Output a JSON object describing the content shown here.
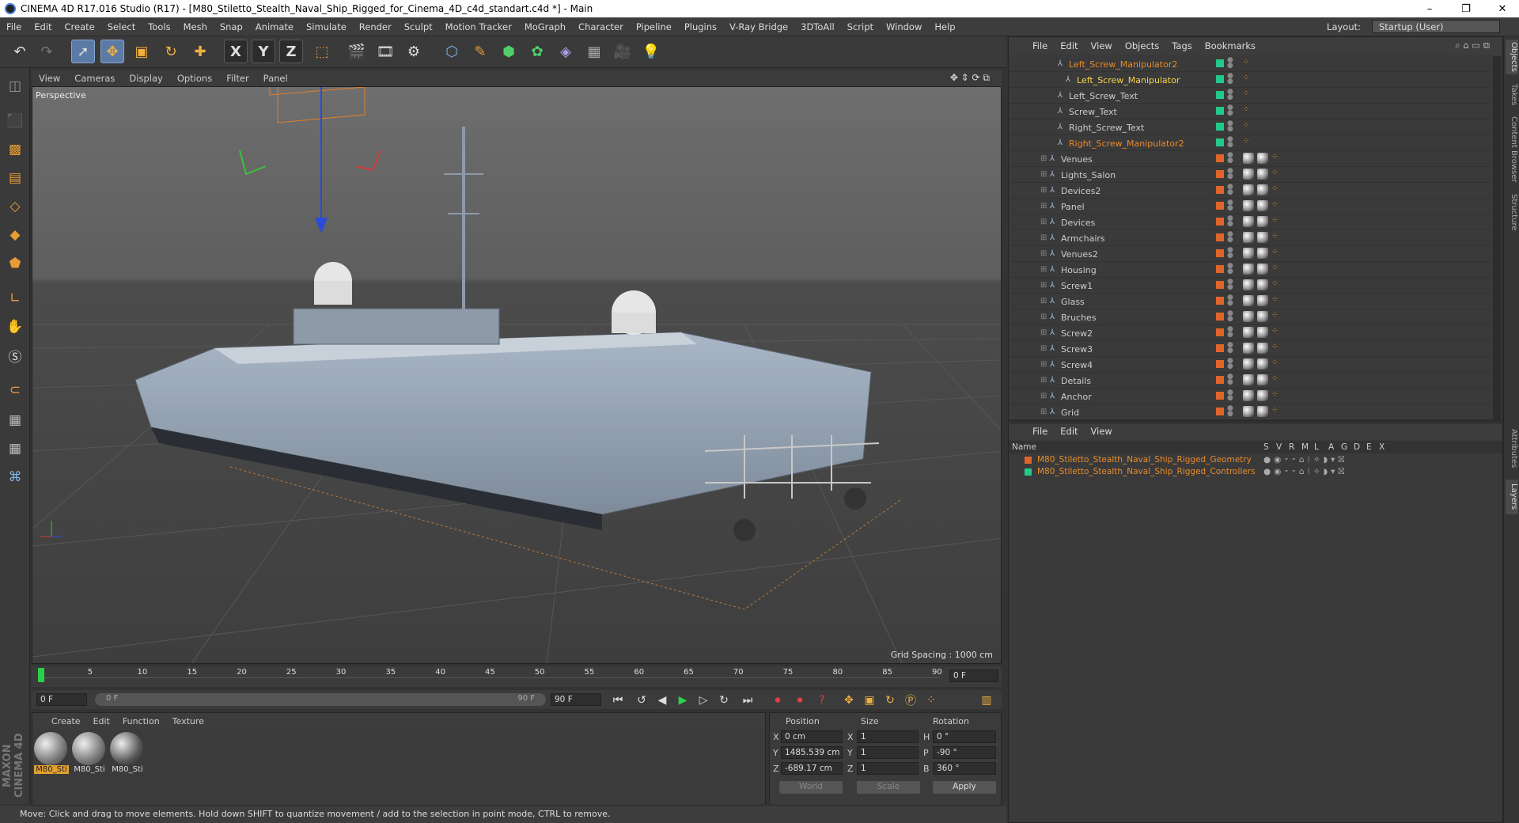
{
  "window": {
    "title": "CINEMA 4D R17.016 Studio (R17) - [M80_Stiletto_Stealth_Naval_Ship_Rigged_for_Cinema_4D_c4d_standart.c4d *] - Main",
    "minimize": "–",
    "restore": "❐",
    "close": "✕"
  },
  "menu": [
    "File",
    "Edit",
    "Create",
    "Select",
    "Tools",
    "Mesh",
    "Snap",
    "Animate",
    "Simulate",
    "Render",
    "Sculpt",
    "Motion Tracker",
    "MoGraph",
    "Character",
    "Pipeline",
    "Plugins",
    "V-Ray Bridge",
    "3DToAll",
    "Script",
    "Window",
    "Help"
  ],
  "layout": {
    "label": "Layout:",
    "value": "Startup (User)"
  },
  "toolbar": {
    "x_label": "X",
    "y_label": "Y",
    "z_label": "Z"
  },
  "viewport": {
    "menu": [
      "View",
      "Cameras",
      "Display",
      "Options",
      "Filter",
      "Panel"
    ],
    "label": "Perspective",
    "grid_spacing": "Grid Spacing : 1000 cm"
  },
  "timeline": {
    "ticks": [
      "0",
      "5",
      "10",
      "15",
      "20",
      "25",
      "30",
      "35",
      "40",
      "45",
      "50",
      "55",
      "60",
      "65",
      "70",
      "75",
      "80",
      "85",
      "90"
    ],
    "current_frame": "0 F",
    "start_field": "0 F",
    "range_start": "0 F",
    "range_end": "90 F",
    "end_field": "90 F"
  },
  "materials": {
    "menu": [
      "Create",
      "Edit",
      "Function",
      "Texture"
    ],
    "items": [
      "M80_Sti",
      "M80_Sti",
      "M80_Sti"
    ]
  },
  "coords": {
    "headers": {
      "position": "Position",
      "size": "Size",
      "rotation": "Rotation"
    },
    "rows": [
      {
        "axis": "X",
        "pos": "0 cm",
        "size_axis": "X",
        "size": "1",
        "rot_axis": "H",
        "rot": "0 °"
      },
      {
        "axis": "Y",
        "pos": "1485.539 cm",
        "size_axis": "Y",
        "size": "1",
        "rot_axis": "P",
        "rot": "-90 °"
      },
      {
        "axis": "Z",
        "pos": "-689.17 cm",
        "size_axis": "Z",
        "size": "1",
        "rot_axis": "B",
        "rot": "360 °"
      }
    ],
    "world": "World",
    "scale": "Scale",
    "apply": "Apply"
  },
  "status": "Move: Click and drag to move elements. Hold down SHIFT to quantize movement / add to the selection in point mode, CTRL to remove.",
  "brand": "MAXON CINEMA 4D",
  "objects": {
    "menu": [
      "File",
      "Edit",
      "View",
      "Objects",
      "Tags",
      "Bookmarks"
    ],
    "rows": [
      {
        "name": "Left_Screw_Manipulator2",
        "style": "hl",
        "indent": 1,
        "swatch": "#22c98a"
      },
      {
        "name": "Left_Screw_Manipulator",
        "style": "act",
        "indent": 2,
        "swatch": "#22c98a"
      },
      {
        "name": "Left_Screw_Text",
        "style": "",
        "indent": 1,
        "swatch": "#22c98a"
      },
      {
        "name": "Screw_Text",
        "style": "",
        "indent": 1,
        "swatch": "#22c98a"
      },
      {
        "name": "Right_Screw_Text",
        "style": "",
        "indent": 1,
        "swatch": "#22c98a"
      },
      {
        "name": "Right_Screw_Manipulator2",
        "style": "hl",
        "indent": 1,
        "swatch": "#22c98a"
      },
      {
        "name": "Venues",
        "style": "",
        "indent": 0,
        "swatch": "#e0652a"
      },
      {
        "name": "Lights_Salon",
        "style": "",
        "indent": 0,
        "swatch": "#e0652a"
      },
      {
        "name": "Devices2",
        "style": "",
        "indent": 0,
        "swatch": "#e0652a"
      },
      {
        "name": "Panel",
        "style": "",
        "indent": 0,
        "swatch": "#e0652a"
      },
      {
        "name": "Devices",
        "style": "",
        "indent": 0,
        "swatch": "#e0652a"
      },
      {
        "name": "Armchairs",
        "style": "",
        "indent": 0,
        "swatch": "#e0652a"
      },
      {
        "name": "Venues2",
        "style": "",
        "indent": 0,
        "swatch": "#e0652a"
      },
      {
        "name": "Housing",
        "style": "",
        "indent": 0,
        "swatch": "#e0652a"
      },
      {
        "name": "Screw1",
        "style": "",
        "indent": 0,
        "swatch": "#e0652a"
      },
      {
        "name": "Glass",
        "style": "",
        "indent": 0,
        "swatch": "#e0652a"
      },
      {
        "name": "Bruches",
        "style": "",
        "indent": 0,
        "swatch": "#e0652a"
      },
      {
        "name": "Screw2",
        "style": "",
        "indent": 0,
        "swatch": "#e0652a"
      },
      {
        "name": "Screw3",
        "style": "",
        "indent": 0,
        "swatch": "#e0652a"
      },
      {
        "name": "Screw4",
        "style": "",
        "indent": 0,
        "swatch": "#e0652a"
      },
      {
        "name": "Details",
        "style": "",
        "indent": 0,
        "swatch": "#e0652a"
      },
      {
        "name": "Anchor",
        "style": "",
        "indent": 0,
        "swatch": "#e0652a"
      },
      {
        "name": "Grid",
        "style": "",
        "indent": 0,
        "swatch": "#e0652a"
      }
    ]
  },
  "layers": {
    "menu": [
      "File",
      "Edit",
      "View"
    ],
    "headers": [
      "Name",
      "S",
      "V",
      "R",
      "M",
      "L",
      "A",
      "G",
      "D",
      "E",
      "X"
    ],
    "rows": [
      {
        "name": "M80_Stiletto_Stealth_Naval_Ship_Rigged_Geometry",
        "swatch": "#e0652a"
      },
      {
        "name": "M80_Stiletto_Stealth_Naval_Ship_Rigged_Controllers",
        "swatch": "#22c98a"
      }
    ]
  },
  "side_tabs": [
    "Objects",
    "Takes",
    "Content Browser",
    "Structure",
    "Attributes",
    "Layers"
  ],
  "colors": {
    "accent": "#5c7aa6",
    "highlight": "#e88b2a",
    "active": "#f5d24a"
  }
}
